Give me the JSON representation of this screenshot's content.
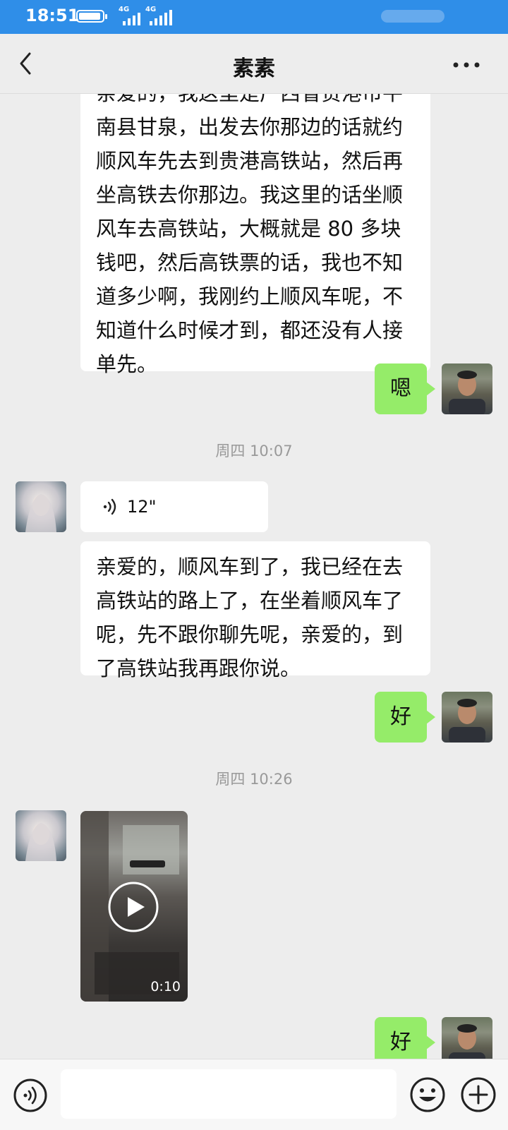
{
  "status_bar": {
    "time": "18:51",
    "net1": "4G",
    "net2": "4G"
  },
  "header": {
    "title": "素素"
  },
  "messages": {
    "m1_lines": [
      "亲爱的，我这里是广西省贵港市平",
      "南县甘泉，出发去你那边的话就约",
      "顺风车先去到贵港高铁站，然后再",
      "坐高铁去你那边。我这里的话坐顺",
      "风车去高铁站，大概就是 80 多块",
      "钱吧，然后高铁票的话，我也不知",
      "道多少啊，我刚约上顺风车呢，不",
      "知道什么时候才到，都还没有人接",
      "单先。"
    ],
    "m2": "嗯",
    "ts1": "周四 10:07",
    "voice_duration": "12\"",
    "m4_lines": [
      "亲爱的，顺风车到了，我已经在去",
      "高铁站的路上了，在坐着顺风车了",
      "呢，先不跟你聊先呢，亲爱的，到",
      "了高铁站我再跟你说。"
    ],
    "m5": "好",
    "ts2": "周四 10:26",
    "video_duration": "0:10",
    "m7": "好"
  },
  "icons": {
    "back": "chevron-left-icon",
    "more": "more-dots-icon",
    "voice_toggle": "voice-icon",
    "emoji": "emoji-icon",
    "add": "plus-icon",
    "play": "play-icon"
  },
  "colors": {
    "status_bar": "#2f8ee8",
    "bubble_self": "#95ec69",
    "bubble_other": "#ffffff",
    "background": "#ededed"
  }
}
